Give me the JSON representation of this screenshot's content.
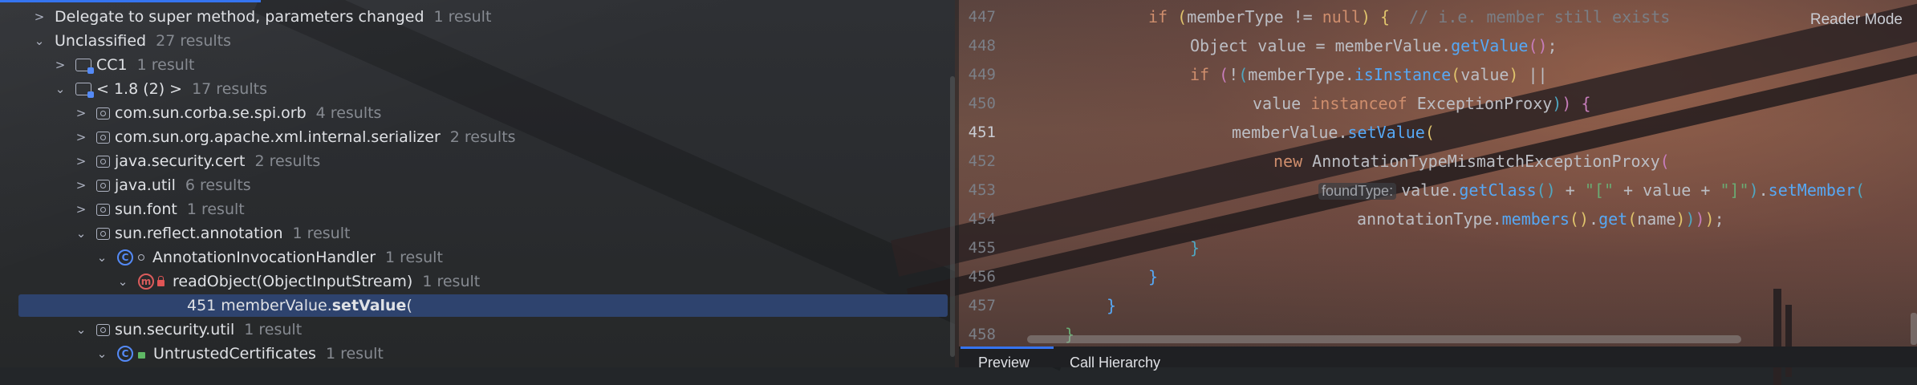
{
  "tree": {
    "rows": [
      {
        "label": "Delegate to super method, parameters changed",
        "count": "1 result"
      },
      {
        "label": "Unclassified",
        "count": "27 results"
      },
      {
        "label": "CC1",
        "count": "1 result"
      },
      {
        "label": "< 1.8 (2) >",
        "count": "17 results"
      },
      {
        "label": "com.sun.corba.se.spi.orb",
        "count": "4 results"
      },
      {
        "label": "com.sun.org.apache.xml.internal.serializer",
        "count": "2 results"
      },
      {
        "label": "java.security.cert",
        "count": "2 results"
      },
      {
        "label": "java.util",
        "count": "6 results"
      },
      {
        "label": "sun.font",
        "count": "1 result"
      },
      {
        "label": "sun.reflect.annotation",
        "count": "1 result"
      },
      {
        "label": "AnnotationInvocationHandler",
        "count": "1 result"
      },
      {
        "label": "readObject(ObjectInputStream)",
        "count": "1 result"
      },
      {
        "label": "sun.security.util",
        "count": "1 result"
      },
      {
        "label": "UntrustedCertificates",
        "count": "1 result"
      }
    ],
    "selected": {
      "line_no": "451",
      "prefix": "memberValue.",
      "method": "setValue",
      "suffix": "("
    }
  },
  "code": {
    "reader_mode": "Reader Mode",
    "line_numbers": [
      "447",
      "448",
      "449",
      "450",
      "451",
      "452",
      "453",
      "454",
      "455",
      "456",
      "457",
      "458"
    ],
    "comment": "// i.e. member still exists",
    "hint": "foundType:"
  },
  "bottom_tabs": {
    "preview": "Preview",
    "call_hierarchy": "Call Hierarchy"
  }
}
